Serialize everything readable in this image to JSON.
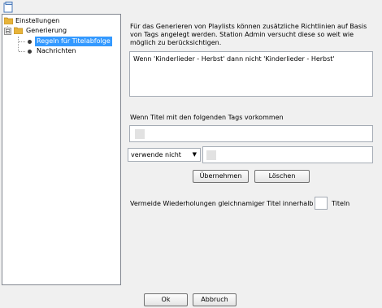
{
  "toolbar": {
    "icon": "page-icon"
  },
  "tree": {
    "root": {
      "label": "Einstellungen",
      "icon": "folder-icon"
    },
    "group": {
      "label": "Generierung",
      "icon": "folder-icon",
      "expander": "⊟"
    },
    "items": [
      {
        "label": "Regeln für Titelabfolge",
        "selected": true
      },
      {
        "label": "Nachrichten",
        "selected": false
      }
    ]
  },
  "content": {
    "description": "Für das Generieren von Playlists können zusätzliche Richtlinien auf Basis von Tags angelegt werden. Station Admin versucht diese so weit wie möglich zu berücksichtigen.",
    "rules": [
      "Wenn 'Kinderlieder - Herbst' dann nicht 'Kinderlieder - Herbst'"
    ],
    "tags_label": "Wenn Titel mit den folgenden Tags vorkommen",
    "mode_select": {
      "value": "verwende nicht"
    },
    "apply_label": "Übernehmen",
    "delete_label": "Löschen",
    "repeat_label_before": "Vermeide Wiederholungen gleichnamiger Titel innerhalb von",
    "repeat_value": "",
    "repeat_label_after": "Titeln"
  },
  "footer": {
    "ok_label": "Ok",
    "cancel_label": "Abbruch"
  },
  "colors": {
    "selection": "#3399ff",
    "folder": "#e8b43a"
  }
}
